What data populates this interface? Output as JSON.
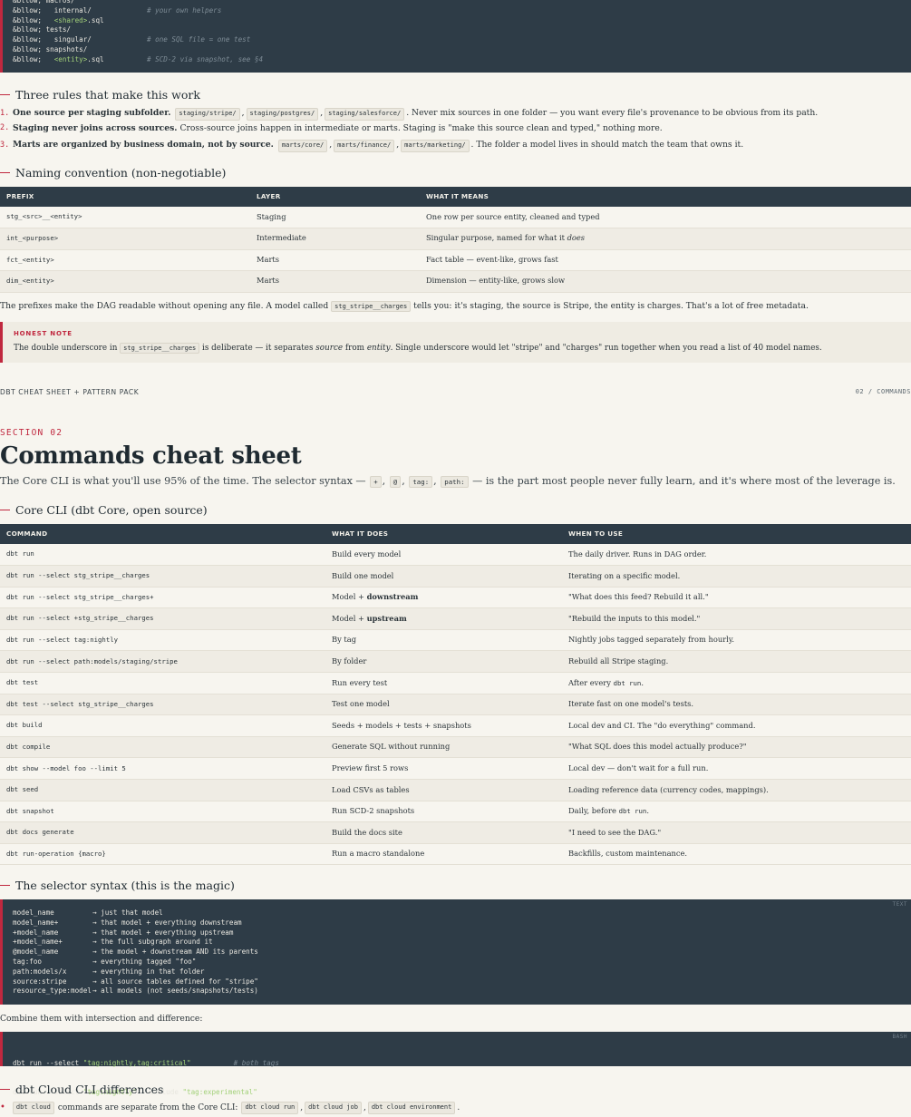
{
  "top_code": {
    "lines": [
      {
        "indent": "",
        "name": "macros/",
        "comment": ""
      },
      {
        "indent": "  ",
        "name": "internal/",
        "comment": "# your own helpers"
      },
      {
        "indent": "  ",
        "tag": "<shared>",
        "suffix": ".sql",
        "comment": ""
      },
      {
        "indent": "",
        "name": "tests/",
        "comment": ""
      },
      {
        "indent": "  ",
        "name": "singular/",
        "comment": "# one SQL file = one test"
      },
      {
        "indent": "",
        "name": "snapshots/",
        "comment": ""
      },
      {
        "indent": "  ",
        "tag": "<entity>",
        "suffix": ".sql",
        "comment": "# SCD-2 via snapshot, see §4"
      }
    ],
    "prefix": "&bllow;"
  },
  "rules": {
    "heading": "Three rules that make this work",
    "items": [
      {
        "num": "1.",
        "bold": "One source per staging subfolder.",
        "codes": [
          "staging/stripe/",
          "staging/postgres/",
          "staging/salesforce/"
        ],
        "text": ". Never mix sources in one folder — you want every file's provenance to be obvious from its path."
      },
      {
        "num": "2.",
        "bold": "Staging never joins across sources.",
        "codes": [],
        "text": "Cross-source joins happen in intermediate or marts. Staging is \"make this source clean and typed,\" nothing more."
      },
      {
        "num": "3.",
        "bold": "Marts are organized by business domain, not by source.",
        "codes": [
          "marts/core/",
          "marts/finance/",
          "marts/marketing/"
        ],
        "text": ". The folder a model lives in should match the team that owns it."
      }
    ]
  },
  "naming": {
    "heading": "Naming convention (non-negotiable)",
    "columns": [
      "PREFIX",
      "LAYER",
      "WHAT IT MEANS"
    ],
    "rows": [
      [
        "stg_<src>__<entity>",
        "Staging",
        "One row per source entity, cleaned and typed"
      ],
      [
        "int_<purpose>",
        "Intermediate",
        "Singular purpose, named for what it does"
      ],
      [
        "fct_<entity>",
        "Marts",
        "Fact table — event-like, grows fast"
      ],
      [
        "dim_<entity>",
        "Marts",
        "Dimension — entity-like, grows slow"
      ]
    ],
    "after_pre": "The prefixes make the DAG readable without opening any file. A model called",
    "after_code": "stg_stripe__charges",
    "after_post": "tells you: it's staging, the source is Stripe, the entity is charges. That's a lot of free metadata."
  },
  "note": {
    "label": "HONEST NOTE",
    "pre": "The double underscore in",
    "code": "stg_stripe__charges",
    "mid1": "is deliberate — it separates",
    "em1": "source",
    "mid2": "from",
    "em2": "entity",
    "post": ". Single underscore would let \"stripe\" and \"charges\" run together when you read a list of 40 model names."
  },
  "footer": {
    "left": "DBT CHEAT SHEET + PATTERN PACK",
    "right": "02 / COMMANDS"
  },
  "section": {
    "label": "SECTION 02",
    "title": "Commands cheat sheet",
    "lead_pre": "The Core CLI is what you'll use 95% of the time. The selector syntax —",
    "lead_codes": [
      "+",
      "@",
      "tag:",
      "path:"
    ],
    "lead_post": "— is the part most people never fully learn, and it's where most of the leverage is."
  },
  "commands": {
    "heading": "Core CLI (dbt Core, open source)",
    "columns": [
      "COMMAND",
      "WHAT IT DOES",
      "WHEN TO USE"
    ],
    "rows": [
      [
        "dbt run",
        "Build every model",
        "The daily driver. Runs in DAG order."
      ],
      [
        "dbt run --select stg_stripe__charges",
        "Build one model",
        "Iterating on a specific model."
      ],
      [
        "dbt run --select stg_stripe__charges+",
        "Model + downstream",
        "\"What does this feed? Rebuild it all.\""
      ],
      [
        "dbt run --select +stg_stripe__charges",
        "Model + upstream",
        "\"Rebuild the inputs to this model.\""
      ],
      [
        "dbt run --select tag:nightly",
        "By tag",
        "Nightly jobs tagged separately from hourly."
      ],
      [
        "dbt run --select path:models/staging/stripe",
        "By folder",
        "Rebuild all Stripe staging."
      ],
      [
        "dbt test",
        "Run every test",
        "After every dbt run."
      ],
      [
        "dbt test --select stg_stripe__charges",
        "Test one model",
        "Iterate fast on one model's tests."
      ],
      [
        "dbt build",
        "Seeds + models + tests + snapshots",
        "Local dev and CI. The \"do everything\" command."
      ],
      [
        "dbt compile",
        "Generate SQL without running",
        "\"What SQL does this model actually produce?\""
      ],
      [
        "dbt show --model foo --limit 5",
        "Preview first 5 rows",
        "Local dev — don't wait for a full run."
      ],
      [
        "dbt seed",
        "Load CSVs as tables",
        "Loading reference data (currency codes, mappings)."
      ],
      [
        "dbt snapshot",
        "Run SCD-2 snapshots",
        "Daily, before dbt run."
      ],
      [
        "dbt docs generate",
        "Build the docs site",
        "\"I need to see the DAG.\""
      ],
      [
        "dbt run-operation {macro}",
        "Run a macro standalone",
        "Backfills, custom maintenance."
      ]
    ]
  },
  "selector": {
    "heading": "The selector syntax (this is the magic)",
    "lang": "TEXT",
    "lines": [
      [
        "model_name",
        "→ just that model"
      ],
      [
        "model_name+",
        "→ that model + everything downstream"
      ],
      [
        "+model_name",
        "→ that model + everything upstream"
      ],
      [
        "+model_name+",
        "→ the full subgraph around it"
      ],
      [
        "@model_name",
        "→ the model + downstream AND its parents"
      ],
      [
        "tag:foo",
        "→ everything tagged \"foo\""
      ],
      [
        "path:models/x",
        "→ everything in that folder"
      ],
      [
        "source:stripe",
        "→ all source tables defined for \"stripe\""
      ],
      [
        "resource_type:model",
        "→ all models (not seeds/snapshots/tests)"
      ]
    ],
    "combine_text": "Combine them with intersection and difference:"
  },
  "bash": {
    "lang": "BASH",
    "line1_cmd": "dbt run --select ",
    "line1_str": "\"tag:nightly,tag:critical\"",
    "line1_comment": "# both tags",
    "line2_cmd": "dbt run --select ",
    "line2_str": "\"tag:nightly\"",
    "line2_mid": " --exclude ",
    "line2_str2": "\"tag:experimental\""
  },
  "cloud": {
    "heading": "dbt Cloud CLI differences",
    "code_first": "dbt cloud",
    "text_mid": "commands are separate from the Core CLI:",
    "codes": [
      "dbt cloud run",
      "dbt cloud job",
      "dbt cloud environment"
    ],
    "text_end": "."
  },
  "colors": {
    "accent": "#c0283f",
    "dark": "#2e3c47",
    "paper": "#f7f5ef"
  }
}
